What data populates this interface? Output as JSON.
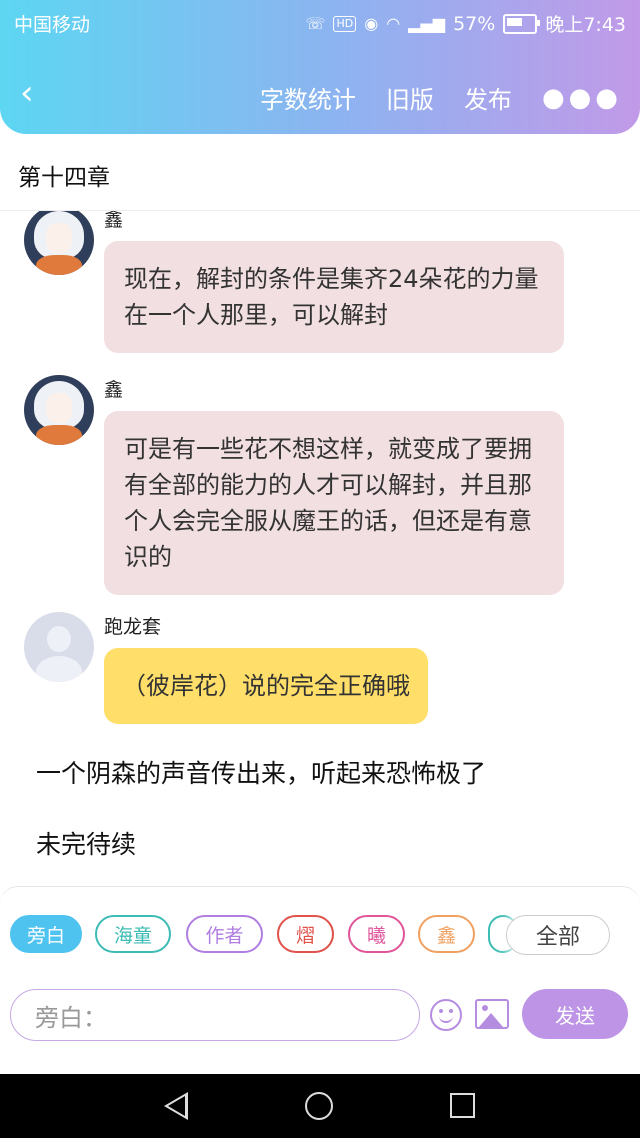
{
  "status_bar": {
    "carrier": "中国移动",
    "battery": "57%",
    "battery_level": 0.57,
    "time": "晚上7:43"
  },
  "nav": {
    "back_icon": "chevron-left-icon",
    "word_count": "字数统计",
    "old_version": "旧版",
    "publish": "发布",
    "more_icon": "more-dots-icon"
  },
  "chapter_title": "第十四章",
  "messages": [
    {
      "name": "鑫",
      "text": "现在，解封的条件是集齐24朵花的力量在一个人那里，可以解封"
    },
    {
      "name": "鑫",
      "text": "可是有一些花不想这样，就变成了要拥有全部的能力的人才可以解封，并且那个人会完全服从魔王的话，但还是有意识的"
    },
    {
      "name": "跑龙套",
      "text": "（彼岸花）说的完全正确哦"
    }
  ],
  "narrations": [
    "一个阴森的声音传出来，听起来恐怖极了",
    "未完待续"
  ],
  "roles": [
    {
      "label": "旁白",
      "color": "#4fc3f0"
    },
    {
      "label": "海童",
      "color": "#3cbcb4"
    },
    {
      "label": "作者",
      "color": "#b07ee0"
    },
    {
      "label": "熠",
      "color": "#e0524a"
    },
    {
      "label": "曦",
      "color": "#e0559a"
    },
    {
      "label": "鑫",
      "color": "#f0a060"
    }
  ],
  "all_roles": "全部",
  "composer": {
    "placeholder": "旁白：",
    "send": "发送"
  }
}
